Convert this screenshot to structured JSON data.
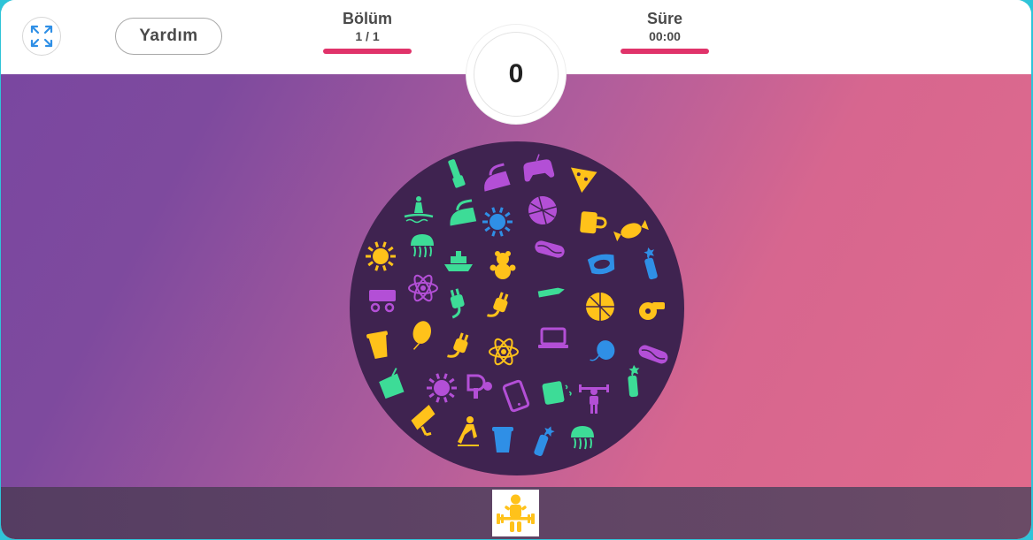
{
  "header": {
    "fullscreen_icon": "expand-arrows-icon",
    "help_label": "Yardım",
    "level": {
      "label": "Bölüm",
      "value": "1 / 1"
    },
    "time": {
      "label": "Süre",
      "value": "00:00"
    },
    "score": "0"
  },
  "colors": {
    "accent_bar": "#e0336a",
    "circle_bg": "#3f2350",
    "green": "#3ddc97",
    "purple": "#b34fd6",
    "yellow": "#ffc21a",
    "blue": "#2f8fe6"
  },
  "board": {
    "icons": [
      {
        "name": "microphone-icon",
        "color": "green"
      },
      {
        "name": "iron-icon",
        "color": "purple"
      },
      {
        "name": "gamepad-icon",
        "color": "purple"
      },
      {
        "name": "pizza-slice-icon",
        "color": "yellow"
      },
      {
        "name": "water-skier-icon",
        "color": "green"
      },
      {
        "name": "iron-icon",
        "color": "green"
      },
      {
        "name": "sun-icon",
        "color": "blue"
      },
      {
        "name": "pizza-icon",
        "color": "purple"
      },
      {
        "name": "coffee-mug-icon",
        "color": "yellow"
      },
      {
        "name": "candy-icon",
        "color": "yellow"
      },
      {
        "name": "sun-icon",
        "color": "yellow"
      },
      {
        "name": "jellyfish-icon",
        "color": "green"
      },
      {
        "name": "ship-icon",
        "color": "green"
      },
      {
        "name": "teddy-bear-icon",
        "color": "yellow"
      },
      {
        "name": "hotdog-icon",
        "color": "purple"
      },
      {
        "name": "diving-mask-icon",
        "color": "blue"
      },
      {
        "name": "dynamite-icon",
        "color": "blue"
      },
      {
        "name": "cart-icon",
        "color": "purple"
      },
      {
        "name": "atom-icon",
        "color": "purple"
      },
      {
        "name": "plug-icon",
        "color": "green"
      },
      {
        "name": "plug-icon",
        "color": "yellow"
      },
      {
        "name": "knife-icon",
        "color": "green"
      },
      {
        "name": "pizza-icon",
        "color": "yellow"
      },
      {
        "name": "whistle-icon",
        "color": "yellow"
      },
      {
        "name": "coffee-cup-icon",
        "color": "yellow"
      },
      {
        "name": "balloon-icon",
        "color": "yellow"
      },
      {
        "name": "plug-icon",
        "color": "yellow"
      },
      {
        "name": "atom-icon",
        "color": "yellow"
      },
      {
        "name": "laptop-icon",
        "color": "purple"
      },
      {
        "name": "yoyo-icon",
        "color": "blue"
      },
      {
        "name": "hotdog-icon",
        "color": "purple"
      },
      {
        "name": "shopping-bag-icon",
        "color": "green"
      },
      {
        "name": "sun-icon",
        "color": "purple"
      },
      {
        "name": "hair-dryer-icon",
        "color": "purple"
      },
      {
        "name": "tablet-icon",
        "color": "purple"
      },
      {
        "name": "toaster-icon",
        "color": "green"
      },
      {
        "name": "weightlifter-icon",
        "color": "purple"
      },
      {
        "name": "dynamite-icon",
        "color": "green"
      },
      {
        "name": "spotlight-icon",
        "color": "yellow"
      },
      {
        "name": "skater-icon",
        "color": "yellow"
      },
      {
        "name": "coffee-cup-icon",
        "color": "blue"
      },
      {
        "name": "dynamite-icon",
        "color": "blue"
      },
      {
        "name": "jellyfish-icon",
        "color": "green"
      }
    ]
  },
  "tray": {
    "target_icon": "weightlifter-icon",
    "target_color": "yellow"
  }
}
